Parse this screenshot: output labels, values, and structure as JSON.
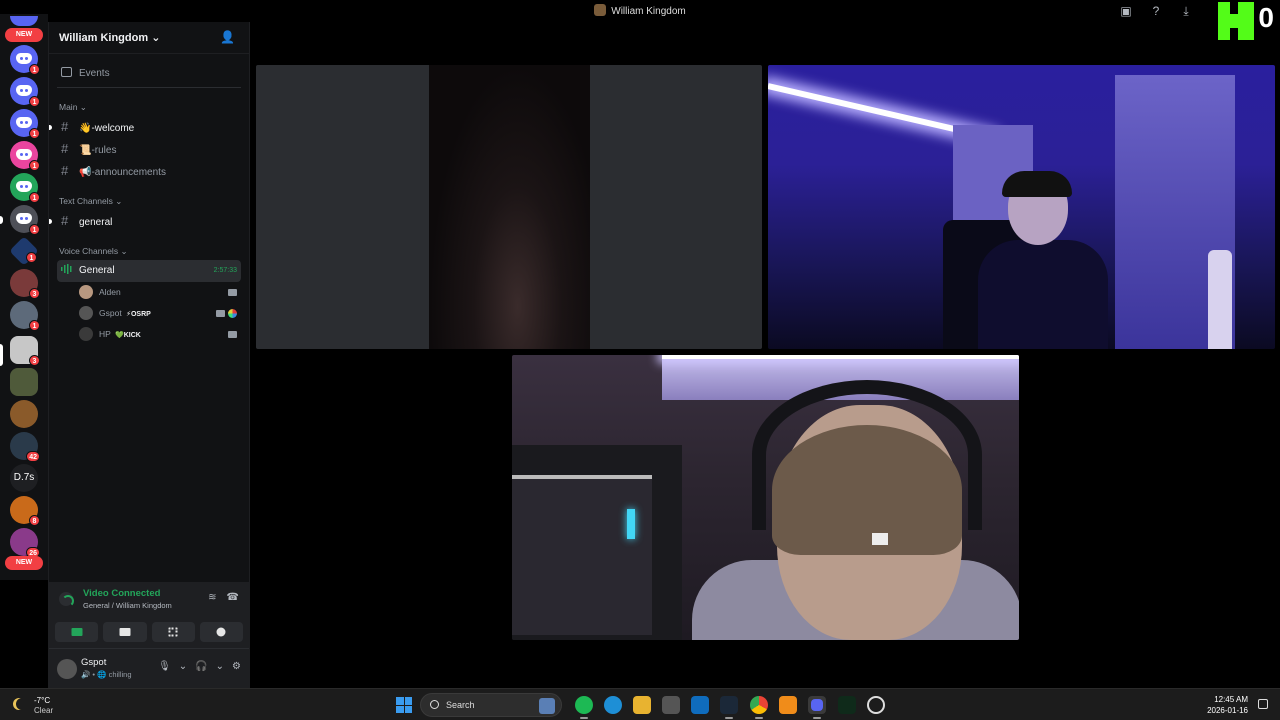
{
  "window": {
    "title": "William Kingdom",
    "kick_count": "0"
  },
  "server_rail": {
    "new_label_top": "NEW",
    "new_label_bottom": "NEW",
    "badges": [
      "1",
      "1",
      "1",
      "1",
      "1",
      "1",
      "1",
      "3",
      "1",
      "3",
      "42",
      "8",
      "26"
    ],
    "text_server": "D.7s"
  },
  "sidebar": {
    "guild_name": "William Kingdom",
    "events_label": "Events",
    "categories": {
      "main": "Main",
      "text": "Text Channels",
      "voice": "Voice Channels"
    },
    "main_channels": [
      "👋-welcome",
      "📜-rules",
      "📢-announcements"
    ],
    "text_channels": [
      "general"
    ],
    "voice_channel": {
      "name": "General",
      "timer": "2:57:33"
    },
    "voice_users": [
      {
        "name": "Alden",
        "tag": ""
      },
      {
        "name": "Gspot",
        "tag": "⚡OSRP"
      },
      {
        "name": "HP",
        "tag": "💚KICK"
      }
    ]
  },
  "voice_panel": {
    "status": "Video Connected",
    "location": "General / William Kingdom"
  },
  "user_panel": {
    "name": "Gspot",
    "status": "chilling"
  },
  "taskbar": {
    "temperature": "-7°C",
    "condition": "Clear",
    "search_placeholder": "Search",
    "time": "12:45 AM",
    "date": "2026-01-16"
  },
  "colors": {
    "accent_green": "#23a55a",
    "discord_blurple": "#5865f2",
    "kick_green": "#53fc18",
    "notification_red": "#f23f43"
  }
}
